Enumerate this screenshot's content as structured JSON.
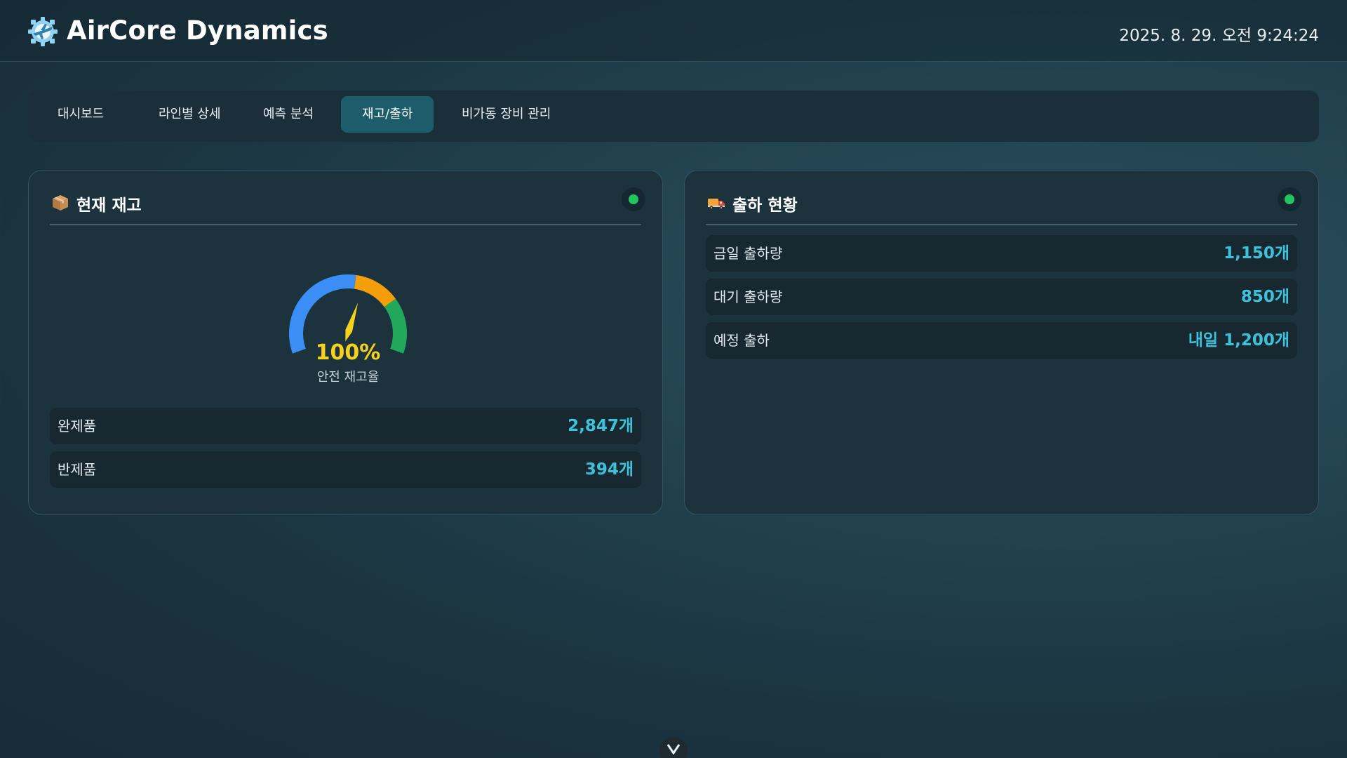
{
  "header": {
    "app_title": "AirCore Dynamics",
    "datetime": "2025. 8. 29. 오전 9:24:24",
    "logo_icon": "gear-airplane-logo-icon"
  },
  "tabs": [
    {
      "label": "대시보드",
      "active": false
    },
    {
      "label": "라인별 상세",
      "active": false
    },
    {
      "label": "예측 분석",
      "active": false
    },
    {
      "label": "재고/출하",
      "active": true
    },
    {
      "label": "비가동 장비 관리",
      "active": false
    }
  ],
  "inventory_card": {
    "title": "현재 재고",
    "icon": "package-icon",
    "status_color": "#22c55e",
    "gauge": {
      "value_text": "100%",
      "value": 100,
      "label": "안전 재고율",
      "segment_colors": [
        "#3b8ef6",
        "#f59e0b",
        "#22a85a"
      ]
    },
    "rows": [
      {
        "label": "완제품",
        "value": "2,847개"
      },
      {
        "label": "반제품",
        "value": "394개"
      }
    ]
  },
  "shipping_card": {
    "title": "출하 현황",
    "icon": "delivery-truck-icon",
    "status_color": "#22c55e",
    "rows": [
      {
        "label": "금일 출하량",
        "value": "1,150개"
      },
      {
        "label": "대기 출하량",
        "value": "850개"
      },
      {
        "label": "예정 출하",
        "value": "내일 1,200개"
      }
    ]
  },
  "scroll_button": {
    "icon": "chevron-down-icon"
  }
}
